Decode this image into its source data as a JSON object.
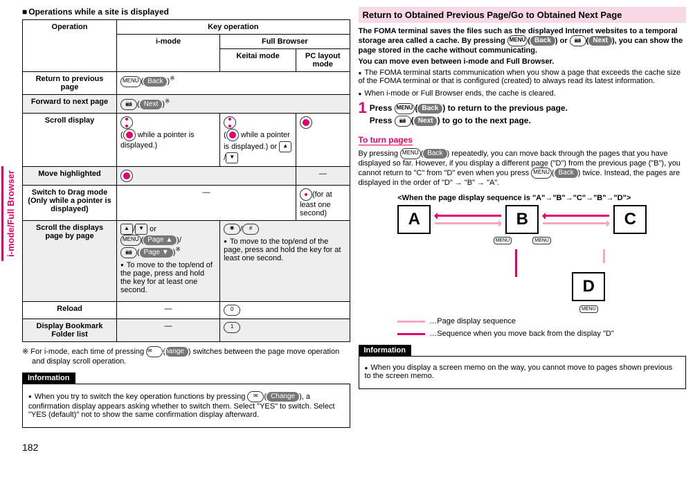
{
  "side_tab": "i-mode/Full Browser",
  "page_number": "182",
  "left": {
    "title": "Operations while a site is displayed",
    "table": {
      "h_operation": "Operation",
      "h_key": "Key operation",
      "h_imode": "i-mode",
      "h_full": "Full Browser",
      "h_keitai": "Keitai mode",
      "h_pc": "PC layout mode",
      "r1_op": "Return to previous page",
      "r1_key": "MENU( Back )※",
      "r2_op": "Forward to next page",
      "r2_key": "📷( Next )※",
      "r3_op": "Scroll display",
      "r3_imode_note": "(      while a pointer is displayed.)",
      "r3_keitai_note": "(      while a pointer is displayed.) or ▲/▼",
      "r4_op": "Move highlighted",
      "r4_pc": "—",
      "r5_op": "Switch to Drag mode (Only while a pointer is displayed)",
      "r5_left": "—",
      "r5_pc": "● (for at least one second)",
      "r6_op": "Scroll the displays page by page",
      "r6_imode": "▲/▼ or MENU( Page ▲ )/📷( Page ▼ )※",
      "r6_imode_note": "To move to the top/end of the page, press and hold the key for at least one second.",
      "r6_full": "✱/#",
      "r6_full_note": "To move to the top/end of the page, press and hold the key for at least one second.",
      "r7_op": "Reload",
      "r7_imode": "—",
      "r7_full": "0",
      "r8_op": "Display Bookmark Folder list",
      "r8_imode": "—",
      "r8_full": "1"
    },
    "footnote": "※ For i-mode, each time of pressing ✉( Change ) switches between the page move operation and display scroll operation.",
    "info_title": "Information",
    "info_text": "When you try to switch the key operation functions by pressing ✉( Change ), a confirmation display appears asking whether to switch them. Select \"YES\" to switch. Select \"YES (default)\" not to show the same confirmation display afterward."
  },
  "right": {
    "title": "Return to Obtained Previous Page/Go to Obtained Next Page",
    "intro1": "The FOMA terminal saves the files such as the displayed Internet websites to a temporal storage area called a cache. By pressing MENU( Back ) or 📷( Next ), you can show the page stored in the cache without communicating.",
    "intro2": "You can move even between i-mode and Full Browser.",
    "b1": "The FOMA terminal starts communication when you show a page that exceeds the cache size of the FOMA terminal or that is configured (created) to always read its latest information.",
    "b2": "When i-mode or Full Browser ends, the cache is cleared.",
    "step_back": "Press MENU( Back ) to return to the previous page.",
    "step_next": "Press 📷( Next ) to go to the next page.",
    "turn_title": "To turn pages",
    "turn_body": "By pressing MENU( Back ) repeatedly, you can move back through the pages that you have displayed so far. However, if you display a different page (\"D\") from the previous page (\"B\"), you cannot return to \"C\" from \"D\" even when you press MENU( Back ) twice. Instead, the pages are displayed in the order of \"D\" → \"B\" → \"A\".",
    "diag_title": "<When the page display sequence is \"A\"→\"B\"→\"C\"→\"B\"→\"D\">",
    "box_a": "A",
    "box_b": "B",
    "box_c": "C",
    "box_d": "D",
    "menu_label": "MENU",
    "legend1": "…Page display sequence",
    "legend2": "…Sequence when you move back from the display \"D\"",
    "info_title": "Information",
    "info_text": "When you display a screen memo on the way, you cannot move to pages shown previous to the screen memo."
  }
}
